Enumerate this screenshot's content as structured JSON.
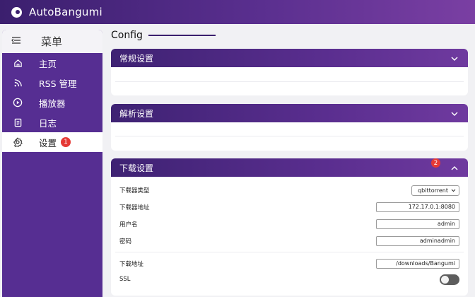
{
  "app": {
    "title": "AutoBangumi"
  },
  "sidebar": {
    "menu_label": "菜单",
    "items": [
      {
        "label": "主页",
        "icon": "home-icon"
      },
      {
        "label": "RSS 管理",
        "icon": "rss-icon"
      },
      {
        "label": "播放器",
        "icon": "play-icon"
      },
      {
        "label": "日志",
        "icon": "log-icon"
      },
      {
        "label": "设置",
        "icon": "gear-icon",
        "active": true,
        "badge": "1"
      }
    ]
  },
  "main": {
    "title": "Config",
    "panels": [
      {
        "title": "常规设置",
        "expanded": false
      },
      {
        "title": "解析设置",
        "expanded": false
      },
      {
        "title": "下载设置",
        "expanded": true,
        "badge": "2",
        "fields": {
          "downloader_type": {
            "label": "下载器类型",
            "value": "qbittorrent"
          },
          "downloader_host": {
            "label": "下载器地址",
            "value": "172.17.0.1:8080"
          },
          "username": {
            "label": "用户名",
            "value": "admin"
          },
          "password": {
            "label": "密码",
            "value": "adminadmin"
          },
          "download_path": {
            "label": "下载地址",
            "value": "/downloads/Bangumi"
          },
          "ssl": {
            "label": "SSL",
            "enabled": false
          }
        }
      }
    ]
  },
  "colors": {
    "accent": "#562e92",
    "badge": "#e53935"
  }
}
